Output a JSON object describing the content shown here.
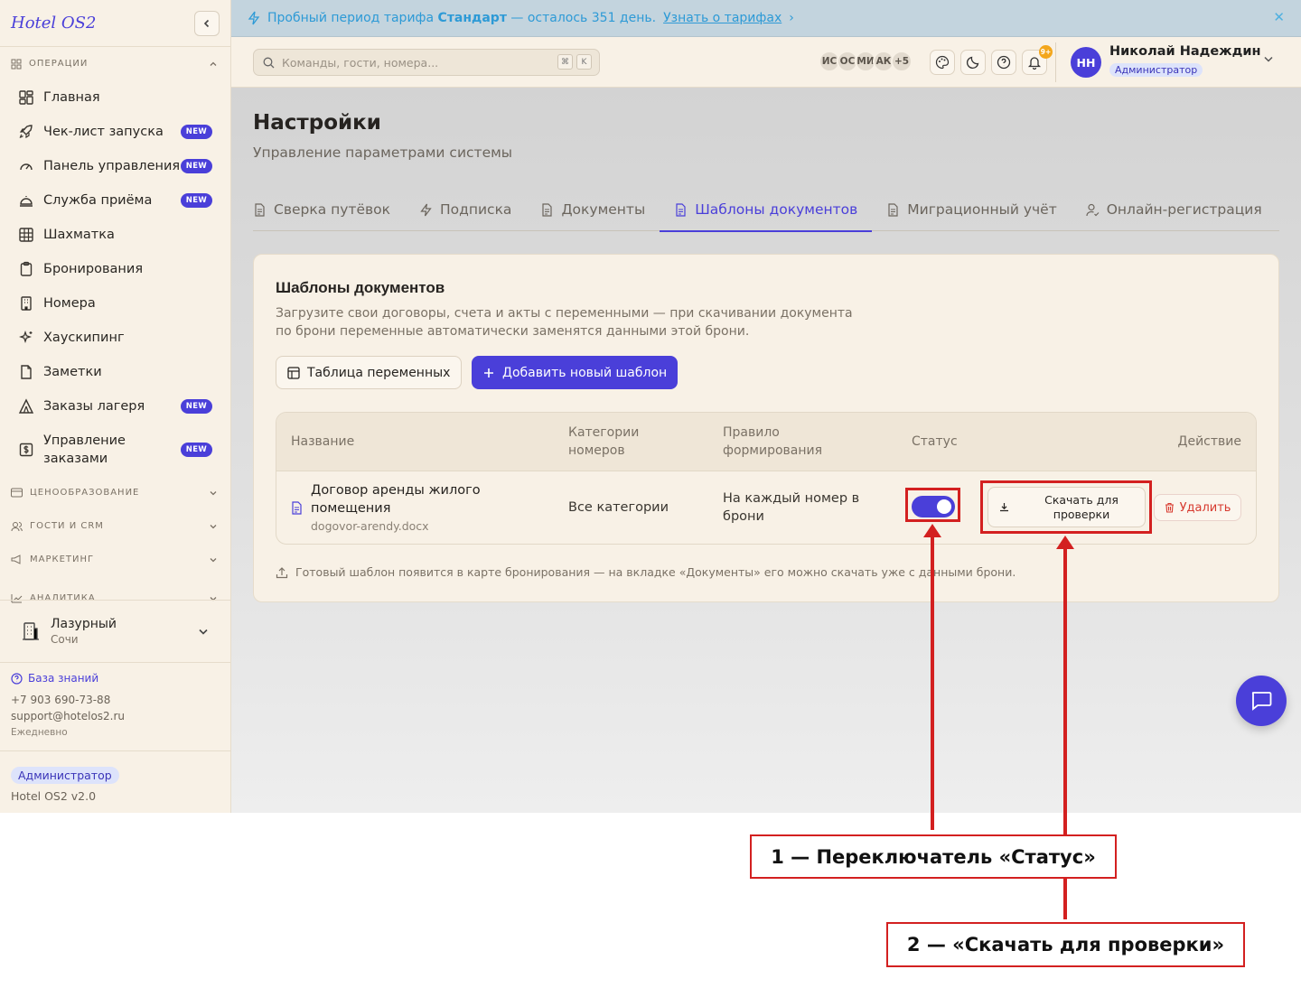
{
  "sidebar": {
    "logo": "Hotel OS2",
    "groups": {
      "operations": "ОПЕРАЦИИ",
      "pricing": "ЦЕНООБРАЗОВАНИЕ",
      "guests": "ГОСТИ И CRM",
      "marketing": "МАРКЕТИНГ",
      "analytics": "АНАЛИТИКА"
    },
    "items": [
      {
        "label": "Главная",
        "icon": "dashboard-icon"
      },
      {
        "label": "Чек-лист запуска",
        "icon": "rocket-icon",
        "badge": "NEW"
      },
      {
        "label": "Панель управления",
        "icon": "gauge-icon",
        "badge": "NEW"
      },
      {
        "label": "Служба приёма",
        "icon": "bell-desk-icon",
        "badge": "NEW"
      },
      {
        "label": "Шахматка",
        "icon": "grid-icon"
      },
      {
        "label": "Бронирования",
        "icon": "clipboard-icon"
      },
      {
        "label": "Номера",
        "icon": "building-icon"
      },
      {
        "label": "Хаускипинг",
        "icon": "sparkles-icon"
      },
      {
        "label": "Заметки",
        "icon": "note-icon"
      },
      {
        "label": "Заказы лагеря",
        "icon": "tent-icon",
        "badge": "NEW"
      },
      {
        "label": "Управление заказами",
        "icon": "dollar-icon",
        "badge": "NEW"
      }
    ],
    "hotel": {
      "name": "Лазурный",
      "city": "Сочи"
    },
    "support": {
      "kb": "База знаний",
      "phone": "+7 903 690-73-88",
      "email": "support@hotelos2.ru",
      "hours": "Ежедневно"
    },
    "role": "Администратор",
    "version": "Hotel OS2 v2.0"
  },
  "banner": {
    "prefix": "Пробный период тарифа ",
    "plan": "Стандарт",
    "suffix": " — осталось 351 день.",
    "link": "Узнать о тарифах",
    "link_arrow": "›",
    "close": "✕"
  },
  "header": {
    "search_placeholder": "Команды, гости, номера...",
    "kbd": [
      "⌘",
      "K"
    ],
    "avatars": [
      "ИС",
      "ОС",
      "МИ",
      "АК",
      "+5"
    ],
    "notif_count": "9+",
    "user": {
      "initials": "НН",
      "name": "Николай Надеждин",
      "role": "Администратор"
    }
  },
  "page": {
    "title": "Настройки",
    "subtitle": "Управление параметрами системы",
    "tabs": [
      {
        "label": "Сверка путёвок",
        "icon": "document-icon"
      },
      {
        "label": "Подписка",
        "icon": "lightning-icon"
      },
      {
        "label": "Документы",
        "icon": "document-icon"
      },
      {
        "label": "Шаблоны документов",
        "icon": "document-icon",
        "active": true
      },
      {
        "label": "Миграционный учёт",
        "icon": "document-icon"
      },
      {
        "label": "Онлайн-регистрация",
        "icon": "user-check-icon"
      }
    ]
  },
  "card": {
    "title": "Шаблоны документов",
    "description": "Загрузите свои договоры, счета и акты с переменными — при скачивании документа по брони переменные автоматически заменятся данными этой брони.",
    "btn_vars": "Таблица переменных",
    "btn_add": "Добавить новый шаблон",
    "columns": {
      "name": "Название",
      "categories_1": "Категории",
      "categories_2": "номеров",
      "rule_1": "Правило",
      "rule_2": "формирования",
      "status": "Статус",
      "action": "Действие"
    },
    "rows": [
      {
        "name_1": "Договор аренды жилого",
        "name_2": "помещения",
        "file": "dogovor-arendy.docx",
        "categories": "Все категории",
        "rule_1": "На каждый номер в",
        "rule_2": "брони",
        "status_on": true,
        "download_1": "Скачать для",
        "download_2": "проверки",
        "delete": "Удалить"
      }
    ],
    "footnote": "Готовый шаблон появится в карте бронирования — на вкладке «Документы» его можно скачать уже с данными брони."
  },
  "annotations": {
    "callout_1": "1 — Переключатель «Статус»",
    "callout_2": "2 — «Скачать для проверки»",
    "color": "#d32020"
  },
  "colors": {
    "accent": "#4a3fd9",
    "sidebar_bg": "#f8f1e6",
    "banner_text": "#2d9ad6",
    "danger": "#d73a2f"
  }
}
